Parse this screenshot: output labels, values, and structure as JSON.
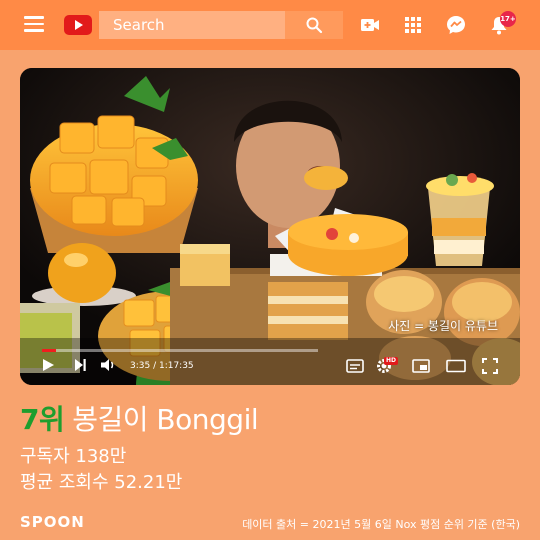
{
  "topbar": {
    "search_placeholder": "Search",
    "notification_count": "17+"
  },
  "video": {
    "photo_credit": "사진 = 봉길이 유튜브",
    "time_display": "3:35 / 1:17:35",
    "progress_fraction": 0.05,
    "hd_label": "HD"
  },
  "channel": {
    "rank": "7위",
    "name": "봉길이 Bonggil",
    "subscribers": "구독자 138만",
    "avg_views": "평균 조회수 52.21만"
  },
  "footer": {
    "logo": "SPOON",
    "source": "데이터 출처 = 2021년 5월 6일 Nox 평점 순위 기준 (한국)"
  },
  "colors": {
    "background": "#F8A36E",
    "topbar": "#FF8A46",
    "rank_green": "#1E9E2E",
    "youtube_red": "#E21A1A"
  }
}
